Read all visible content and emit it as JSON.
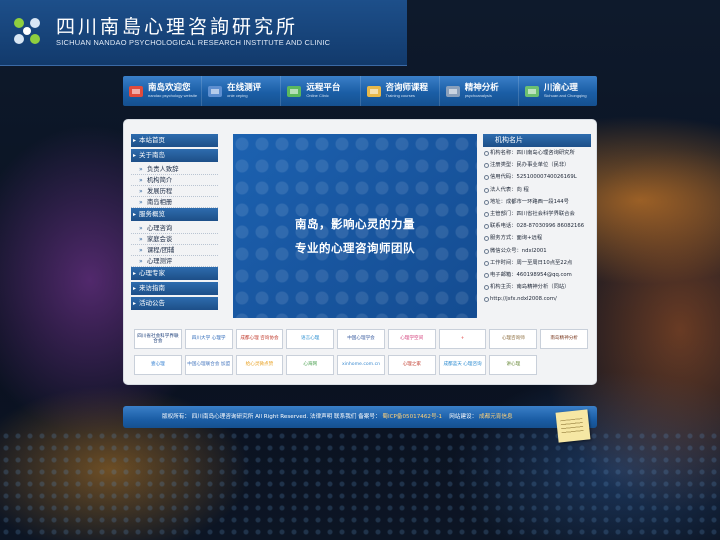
{
  "header": {
    "title_cn": "四川南島心理咨詢研究所",
    "title_en": "SICHUAN NANDAO PSYCHOLOGICAL RESEARCH INSTITUTE AND CLINIC"
  },
  "nav": [
    {
      "label": "南岛欢迎您",
      "sub": "nandao psychology website",
      "icon": "house-icon",
      "color": "#e04b3c"
    },
    {
      "label": "在线测评",
      "sub": "onie ceping",
      "icon": "computer-icon",
      "color": "#5e8fd0"
    },
    {
      "label": "远程平台",
      "sub": "Online Clinic",
      "icon": "people-icon",
      "color": "#5bb85d"
    },
    {
      "label": "咨询师课程",
      "sub": "Training courses",
      "icon": "book-icon",
      "color": "#e8b84a"
    },
    {
      "label": "精神分析",
      "sub": "psychoanalysis",
      "icon": "laptop-icon",
      "color": "#8aa0bb"
    },
    {
      "label": "川渝心理",
      "sub": "Sichuan and Chongqing",
      "icon": "handshake-icon",
      "color": "#6cc070"
    }
  ],
  "sidebar": {
    "groups": [
      {
        "label": "本站首页",
        "items": []
      },
      {
        "label": "关于南岛",
        "items": [
          "负责人致辞",
          "机构简介",
          "发展历程",
          "南岛相册"
        ]
      },
      {
        "label": "服务概览",
        "items": [
          "心理咨询",
          "家庭会谈",
          "课程/团辅",
          "心理测评"
        ]
      },
      {
        "label": "心理专家",
        "items": []
      },
      {
        "label": "来访指南",
        "items": []
      },
      {
        "label": "活动公告",
        "items": []
      }
    ]
  },
  "banner": {
    "line1": "南岛，影响心灵的力量",
    "line2": "专业的心理咨询师团队"
  },
  "info": {
    "title": "机构名片",
    "rows": [
      "机构名称：四川南岛心理咨询研究所",
      "注册类型：民办事业单位（民非）",
      "信用代码：52510000740026169L",
      "法人代表：向 程",
      "地址：成都市一环路西一段144号",
      "主管部门：四川省社会科学界联合会",
      "联系电话：028-87030996 86082166",
      "服务方式：面询+远程",
      "微信公众号：ndxl2001",
      "工作时间：周一至周日10点至22点",
      "电子邮箱：460198954@qq.com",
      "机构主页：南岛精神分析（同站）",
      "http://jsfx.ndxl2008.com/"
    ]
  },
  "partners": [
    {
      "label": "四川省社会科学界联合会",
      "color": "#1c3f7a"
    },
    {
      "label": "四川大学 心理学",
      "color": "#2a67b8"
    },
    {
      "label": "成都心理 咨询协会",
      "color": "#c0392b"
    },
    {
      "label": "语言心理",
      "color": "#2b8fd1"
    },
    {
      "label": "中国心理学会",
      "color": "#3a5da0"
    },
    {
      "label": "心理学空间",
      "color": "#d33d7a"
    },
    {
      "label": "+",
      "color": "#e03a3a"
    },
    {
      "label": "心理咨询师",
      "color": "#8a6a3a"
    },
    {
      "label": "南岛精神分析",
      "color": "#7b3a20"
    },
    {
      "label": "壹心理",
      "color": "#2a7ad0"
    },
    {
      "label": "中国心理联合会 加盟",
      "color": "#4a7ac0"
    },
    {
      "label": "给心灵微点赞",
      "color": "#e8a020"
    },
    {
      "label": "心海网",
      "color": "#4aa050"
    },
    {
      "label": "xinhome.com.cn",
      "color": "#3a8ad0"
    },
    {
      "label": "心理之家",
      "color": "#c0392b"
    },
    {
      "label": "成都蓝天 心理咨询",
      "color": "#2a8ad0"
    },
    {
      "label": "讲心理",
      "color": "#6a8a3a"
    }
  ],
  "footer": {
    "prefix": "版权所有：",
    "owner": "四川南岛心理咨询研究所 All Right Reserved. 法律声明 联系我们 备案号：",
    "icp": "蜀ICP备05017462号-1",
    "build_label": "网站建设：",
    "builder": "成都元宵信息"
  }
}
